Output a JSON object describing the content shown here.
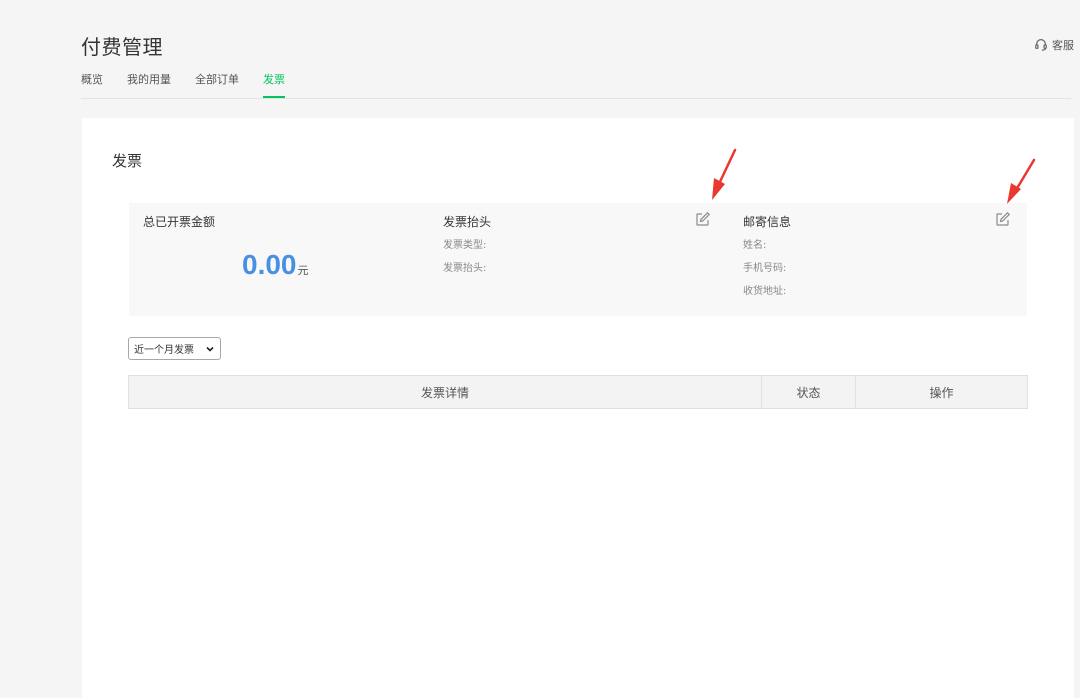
{
  "header": {
    "title": "付费管理",
    "support_label": "客服"
  },
  "tabs": [
    {
      "label": "概览",
      "active": false
    },
    {
      "label": "我的用量",
      "active": false
    },
    {
      "label": "全部订单",
      "active": false
    },
    {
      "label": "发票",
      "active": true
    }
  ],
  "card": {
    "title": "发票",
    "summary": {
      "amount": {
        "title": "总已开票金额",
        "value": "0.00",
        "unit": "元"
      },
      "invoice_header": {
        "title": "发票抬头",
        "fields": [
          "发票类型:",
          "发票抬头:"
        ],
        "edit_icon": "edit-icon"
      },
      "mailing": {
        "title": "邮寄信息",
        "fields": [
          "姓名:",
          "手机号码:",
          "收货地址:"
        ],
        "edit_icon": "edit-icon"
      }
    },
    "filter": {
      "selected": "近一个月发票"
    },
    "table": {
      "columns": [
        "发票详情",
        "状态",
        "操作"
      ]
    }
  },
  "colors": {
    "accent_green": "#07c160",
    "amount_blue": "#4a90e2",
    "annotation_red": "#e8382f"
  }
}
